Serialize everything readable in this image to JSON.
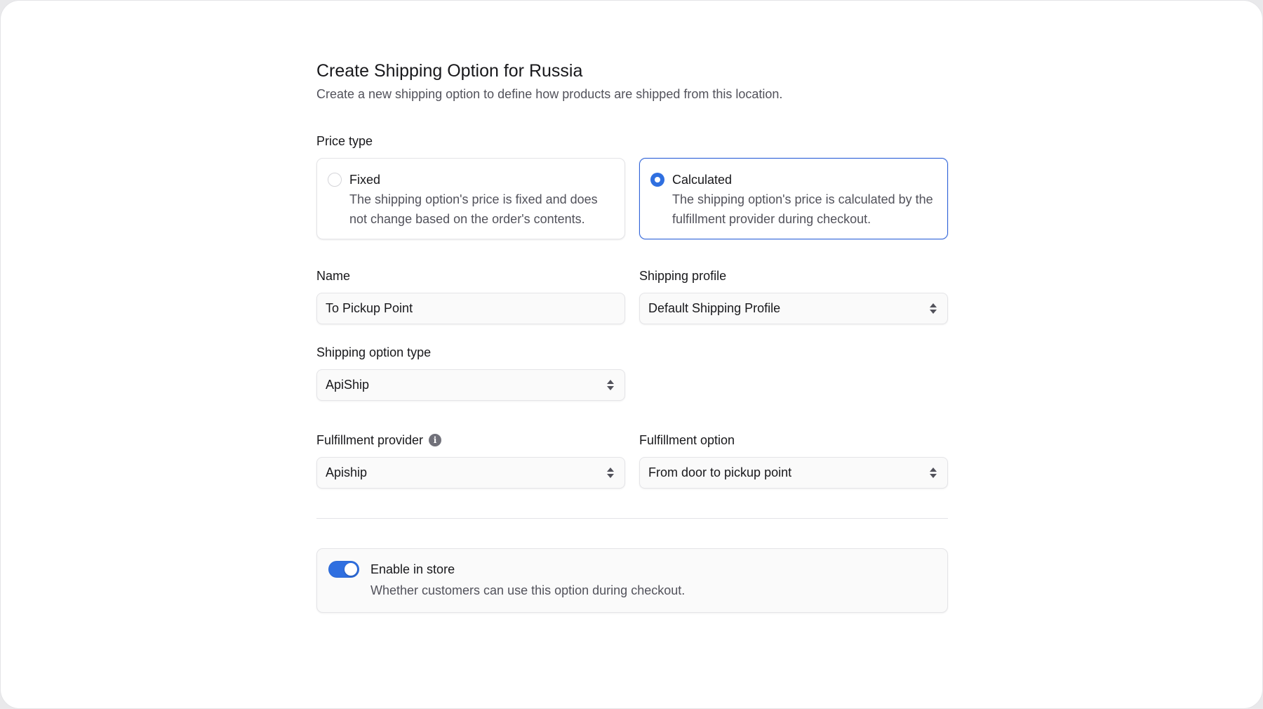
{
  "header": {
    "title": "Create Shipping Option for Russia",
    "subtitle": "Create a new shipping option to define how products are shipped from this location."
  },
  "price_type": {
    "label": "Price type",
    "selected": "calculated",
    "options": [
      {
        "id": "fixed",
        "title": "Fixed",
        "description": "The shipping option's price is fixed and does not change based on the order's contents."
      },
      {
        "id": "calculated",
        "title": "Calculated",
        "description": "The shipping option's price is calculated by the fulfillment provider during checkout."
      }
    ]
  },
  "fields": {
    "name": {
      "label": "Name",
      "value": "To Pickup Point"
    },
    "shipping_profile": {
      "label": "Shipping profile",
      "value": "Default Shipping Profile"
    },
    "shipping_option_type": {
      "label": "Shipping option type",
      "value": "ApiShip"
    },
    "fulfillment_provider": {
      "label": "Fulfillment provider",
      "value": "Apiship",
      "info_icon": "info-icon"
    },
    "fulfillment_option": {
      "label": "Fulfillment option",
      "value": "From door to pickup point"
    }
  },
  "enable_in_store": {
    "title": "Enable in store",
    "description": "Whether customers can use this option during checkout.",
    "enabled": true
  },
  "colors": {
    "accent": "#2f6fe0",
    "selected_border": "#2f63d8",
    "text_primary": "#18181b",
    "text_secondary": "#52525b",
    "border": "#e4e4e7"
  }
}
